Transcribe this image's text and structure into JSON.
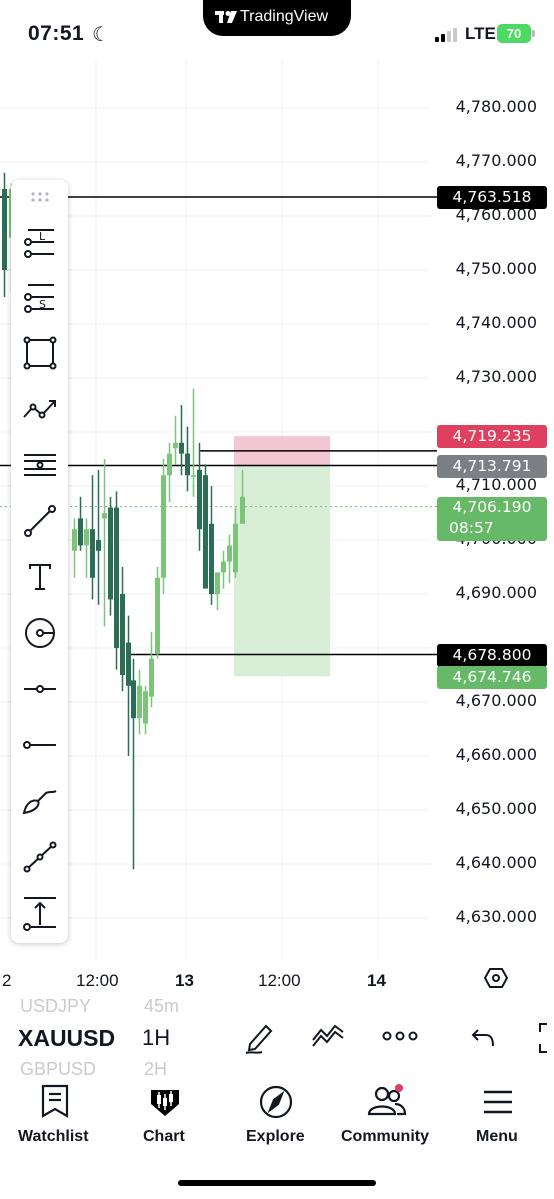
{
  "status_bar": {
    "time": "07:51",
    "carrier": "LTE",
    "battery": "70",
    "island_app": "TradingView"
  },
  "colors": {
    "bull": "#7cc47a",
    "bear": "#2b6e55",
    "stop_zone": "#f3c6d3",
    "target_zone": "#d9eed7",
    "red_tag": "#e0405f",
    "grey_tag": "#7c7f86",
    "green_tag": "#66b966",
    "black_tag": "#000000"
  },
  "price_axis": {
    "labels": [
      "4,780.000",
      "4,770.000",
      "4,760.000",
      "4,750.000",
      "4,740.000",
      "4,730.000",
      "4,710.000",
      "4,700.000",
      "4,690.000",
      "4,670.000",
      "4,660.000",
      "4,650.000",
      "4,640.000",
      "4,630.000"
    ]
  },
  "price_tags": {
    "line_top": "4,763.518",
    "take_profit": "4,719.235",
    "entry": "4,713.791",
    "current_price": "4,706.190",
    "countdown": "08:57",
    "line_bottom": "4,678.800",
    "stop": "4,674.746"
  },
  "time_axis": [
    "2",
    "12:00",
    "13",
    "12:00",
    "14"
  ],
  "drawing_tools": [
    {
      "icon": "long-position-icon"
    },
    {
      "icon": "short-position-icon"
    },
    {
      "icon": "rectangle-icon"
    },
    {
      "icon": "path-icon"
    },
    {
      "icon": "parallel-channel-icon"
    },
    {
      "icon": "trend-line-icon"
    },
    {
      "icon": "text-icon"
    },
    {
      "icon": "circle-icon"
    },
    {
      "icon": "horizontal-ray-icon"
    },
    {
      "icon": "ray-icon"
    },
    {
      "icon": "brush-icon"
    },
    {
      "icon": "trend-line-2-icon"
    },
    {
      "icon": "price-range-icon"
    }
  ],
  "symbol_bar": {
    "symbol": "XAUUSD",
    "interval": "1H",
    "prev_symbol": "USDJPY",
    "prev_interval": "45m",
    "next_symbol": "GBPUSD",
    "next_interval": "2H"
  },
  "tabs": [
    {
      "label": "Watchlist",
      "icon": "bookmark-icon"
    },
    {
      "label": "Chart",
      "icon": "chart-icon"
    },
    {
      "label": "Explore",
      "icon": "compass-icon"
    },
    {
      "label": "Community",
      "icon": "community-icon"
    },
    {
      "label": "Menu",
      "icon": "menu-icon"
    }
  ]
}
